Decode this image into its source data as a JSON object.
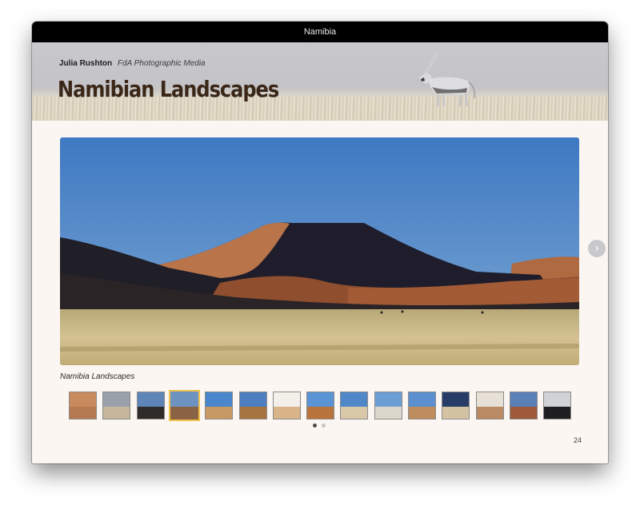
{
  "window": {
    "title": "Namibia"
  },
  "banner": {
    "author": "Julia Rushton",
    "publisher": "FdA Photographic Media",
    "title": "Namibian Landscapes"
  },
  "gallery": {
    "caption": "Namibia Landscapes",
    "next_icon": "chevron-right-icon",
    "selected_index": 3,
    "thumbnails": [
      {
        "sky": "#c98a5e",
        "ground": "#b57a52"
      },
      {
        "sky": "#9aa0ab",
        "ground": "#c7b79a"
      },
      {
        "sky": "#5f85b8",
        "ground": "#2e2b28"
      },
      {
        "sky": "#6e93c0",
        "ground": "#8a6244"
      },
      {
        "sky": "#4a86cc",
        "ground": "#c79a63"
      },
      {
        "sky": "#4c7ec0",
        "ground": "#a6743f"
      },
      {
        "sky": "#f3efe9",
        "ground": "#d8b488"
      },
      {
        "sky": "#5a94d4",
        "ground": "#b8743c"
      },
      {
        "sky": "#4f87c9",
        "ground": "#d9c9a9"
      },
      {
        "sky": "#6b9ed5",
        "ground": "#dcd7cc"
      },
      {
        "sky": "#5b8fcf",
        "ground": "#bf8d5d"
      },
      {
        "sky": "#273d67",
        "ground": "#d4c3a3"
      },
      {
        "sky": "#e7e0d6",
        "ground": "#b98a63"
      },
      {
        "sky": "#5b7fb7",
        "ground": "#9e5a3b"
      },
      {
        "sky": "#cfd2d6",
        "ground": "#1e1e20"
      }
    ],
    "page_dots": 2,
    "active_dot": 0
  },
  "page_number": "24"
}
